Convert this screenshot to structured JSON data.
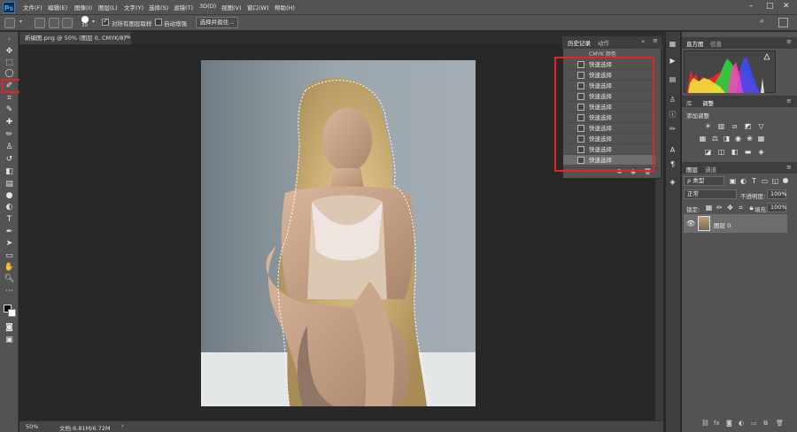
{
  "app": {
    "logo": "Ps"
  },
  "menubar": {
    "items": [
      "文件(F)",
      "编辑(E)",
      "图像(I)",
      "图层(L)",
      "文字(Y)",
      "选择(S)",
      "滤镜(T)",
      "3D(D)",
      "视图(V)",
      "窗口(W)",
      "帮助(H)"
    ],
    "window_buttons": [
      "–",
      "□",
      "✕"
    ]
  },
  "options_bar": {
    "brush_size": "30",
    "sample_all_layers_label": "对所有图层取样",
    "sample_all_layers_checked": true,
    "auto_enhance_label": "自动增强",
    "auto_enhance_checked": false,
    "refine_button_label": "选择并遮住..."
  },
  "document": {
    "tab_title": "新编图.png @ 50% (图层 0, CMYK/8) *",
    "zoom": "50%",
    "doc_size": "文档:6.81M/6.72M"
  },
  "history_panel": {
    "tabs": [
      "历史记录",
      "动作"
    ],
    "snapshot_label": "CMYK 颜色",
    "items": [
      "快速选择",
      "快速选择",
      "快速选择",
      "快速选择",
      "快速选择",
      "快速选择",
      "快速选择",
      "快速选择",
      "快速选择",
      "快速选择"
    ],
    "selected_index": 9
  },
  "histogram_panel": {
    "tabs": [
      "直方图",
      "信息"
    ]
  },
  "adjustments_panel": {
    "tabs": [
      "库",
      "调整"
    ],
    "title": "添加调整"
  },
  "layers_panel": {
    "tabs": [
      "图层",
      "通道"
    ],
    "filter_label": "ρ 类型",
    "blend_mode": "正常",
    "opacity_label": "不透明度:",
    "opacity_value": "100%",
    "lock_label": "锁定:",
    "fill_label": "填充:",
    "fill_value": "100%",
    "layer_name": "图层 0"
  },
  "colors": {
    "highlight_red": "#e0242a",
    "menubar_bg": "#535353",
    "canvas_bg": "#282828"
  }
}
